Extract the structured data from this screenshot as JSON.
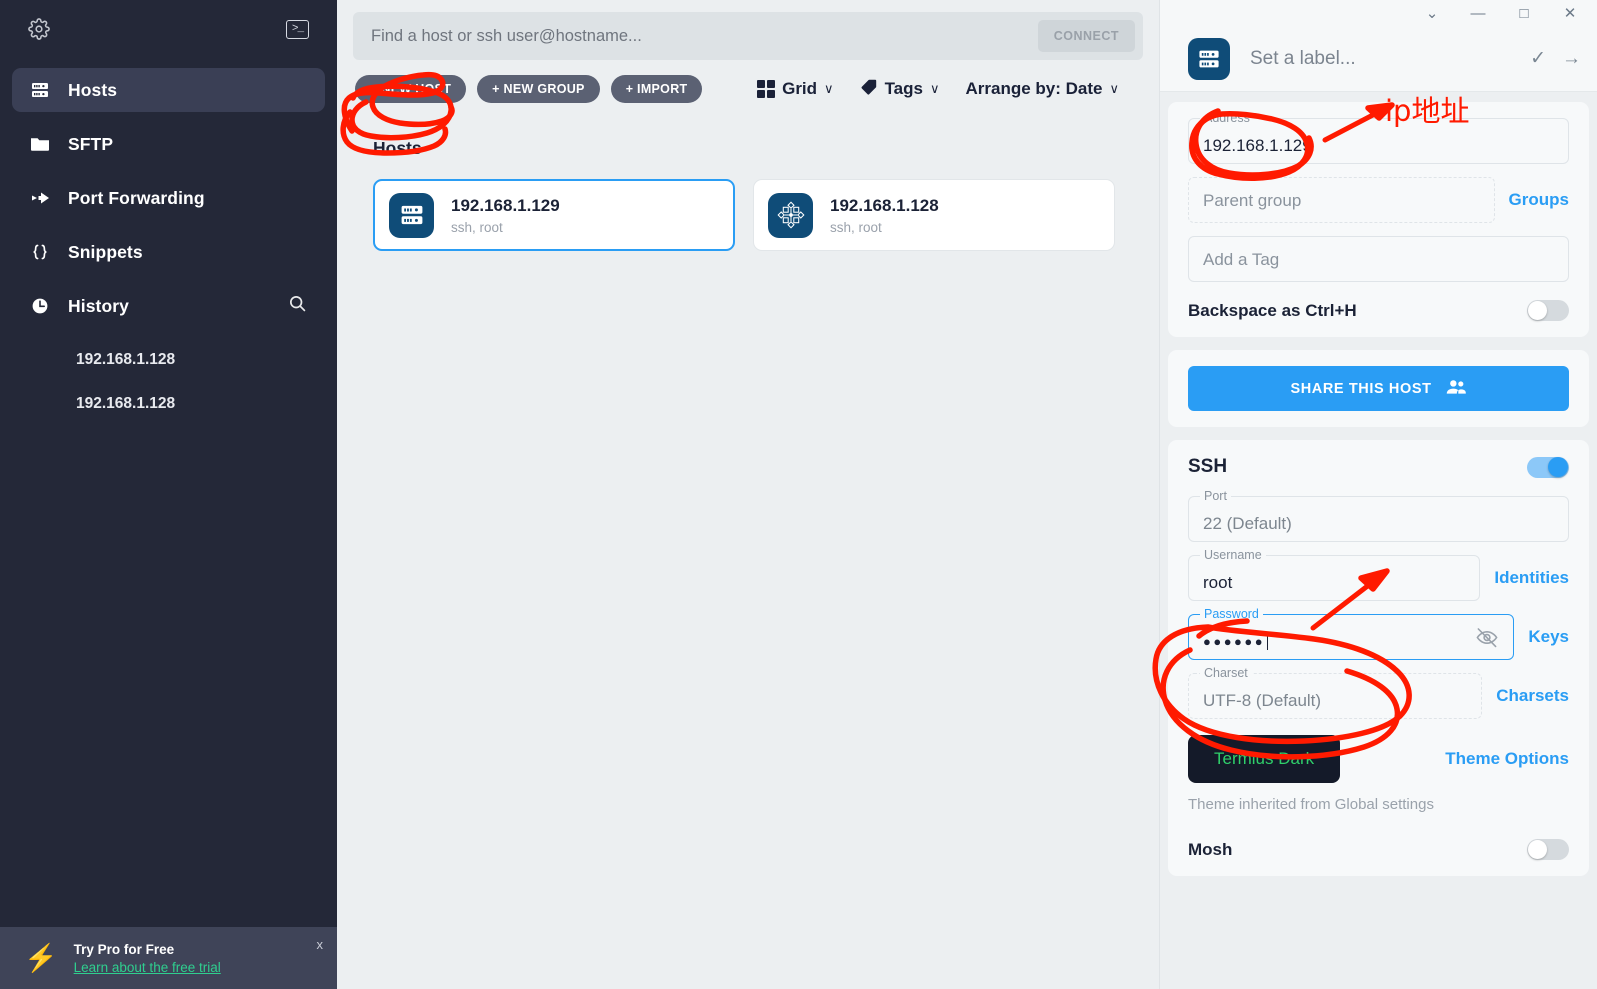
{
  "sidebar": {
    "gear_icon": "gear-icon",
    "terminal_icon": "terminal-icon",
    "items": [
      {
        "label": "Hosts",
        "icon": "server-icon",
        "active": true
      },
      {
        "label": "SFTP",
        "icon": "folder-icon",
        "active": false
      },
      {
        "label": "Port Forwarding",
        "icon": "forward-arrow-icon",
        "active": false
      },
      {
        "label": "Snippets",
        "icon": "braces-icon",
        "active": false
      },
      {
        "label": "History",
        "icon": "clock-icon",
        "active": false
      }
    ],
    "history": [
      "192.168.1.128",
      "192.168.1.128"
    ],
    "promo": {
      "title": "Try Pro for Free",
      "link": "Learn about the free trial",
      "close": "x",
      "bolt_icon": "lightning-bolt-icon"
    }
  },
  "main": {
    "search": {
      "placeholder": "Find a host or ssh user@hostname...",
      "value": "",
      "connect_label": "CONNECT"
    },
    "toolbar": {
      "new_host": "+ NEW HOST",
      "new_group": "+ NEW GROUP",
      "import": "+ IMPORT",
      "view_mode": "Grid",
      "tags": "Tags",
      "arrange": "Arrange by: Date",
      "chevron": "∨"
    },
    "section_title": "Hosts",
    "hosts": [
      {
        "name": "192.168.1.129",
        "sub": "ssh, root",
        "icon": "server-icon",
        "selected": true
      },
      {
        "name": "192.168.1.128",
        "sub": "ssh, root",
        "icon": "centos-logo-icon",
        "selected": false
      }
    ]
  },
  "right_panel": {
    "window_controls": {
      "collapse": "⌄",
      "minimize": "—",
      "maximize": "□",
      "close": "✕"
    },
    "header": {
      "icon": "server-icon",
      "label_placeholder": "Set a label...",
      "label_value": "",
      "confirm_icon": "check-icon",
      "next_icon": "arrow-right-icon"
    },
    "general": {
      "address_label": "Address *",
      "address_value": "192.168.1.129",
      "parent_group_placeholder": "Parent group",
      "groups_link": "Groups",
      "tag_placeholder": "Add a Tag",
      "backspace_label": "Backspace as Ctrl+H",
      "backspace_on": false
    },
    "share": {
      "label": "SHARE THIS HOST",
      "icon": "people-icon"
    },
    "ssh": {
      "title": "SSH",
      "enabled": true,
      "port_label": "Port",
      "port_value": "22 (Default)",
      "username_label": "Username",
      "username_value": "root",
      "identities_link": "Identities",
      "password_label": "Password",
      "password_value": "●●●●●●",
      "password_eye_icon": "eye-off-icon",
      "keys_link": "Keys",
      "charset_label": "Charset",
      "charset_value": "UTF-8 (Default)",
      "charsets_link": "Charsets",
      "theme_name": "Termius Dark",
      "theme_options_link": "Theme Options",
      "theme_note": "Theme inherited from Global settings",
      "mosh_label": "Mosh",
      "mosh_on": false
    }
  },
  "annotations": {
    "chinese_note": "ip地址",
    "color": "#ff1a00"
  }
}
